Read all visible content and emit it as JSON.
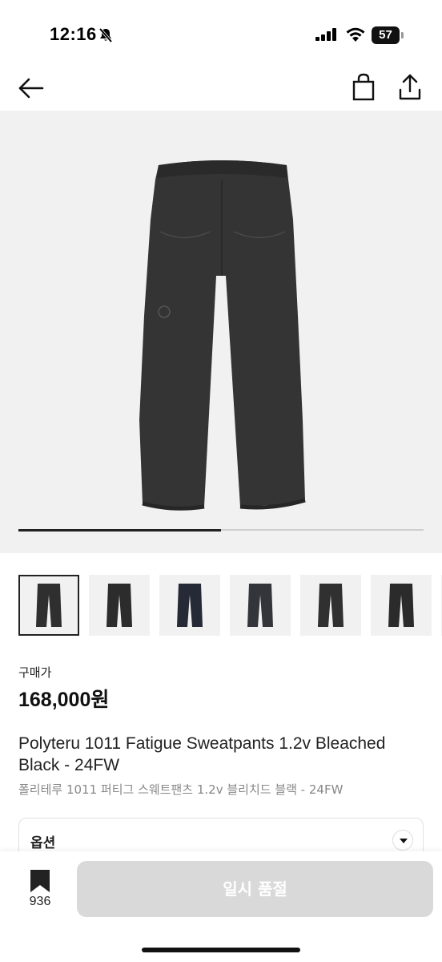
{
  "status_bar": {
    "time": "12:16",
    "battery": "57"
  },
  "product": {
    "gallery": {
      "image_count": 7,
      "current_index": 1,
      "progress_fraction": 0.5,
      "thumbnails": [
        {
          "color": "#2f2f2f",
          "selected": true
        },
        {
          "color": "#2c2c2c",
          "selected": false
        },
        {
          "color": "#252a36",
          "selected": false
        },
        {
          "color": "#33353a",
          "selected": false
        },
        {
          "color": "#303030",
          "selected": false
        },
        {
          "color": "#2b2b2b",
          "selected": false
        }
      ]
    },
    "price_label": "구매가",
    "price": "168,000원",
    "title_en": "Polyteru 1011 Fatigue Sweatpants 1.2v Bleached Black - 24FW",
    "title_ko": "폴리테루 1011 퍼티그 스웨트팬츠 1.2v 블리치드 블랙 - 24FW"
  },
  "options": {
    "label": "옵션"
  },
  "bottom_bar": {
    "bookmark_count": "936",
    "action_label": "일시 품절"
  },
  "icons": {
    "back": "arrow-left-icon",
    "bag": "shopping-bag-icon",
    "share": "share-icon",
    "bookmark": "bookmark-icon",
    "option_toggle": "chevron-down-icon"
  },
  "colors": {
    "disabled_button": "#d9d9d9",
    "hero_background": "#f1f1f1",
    "product_color": "#2f2f2f"
  }
}
